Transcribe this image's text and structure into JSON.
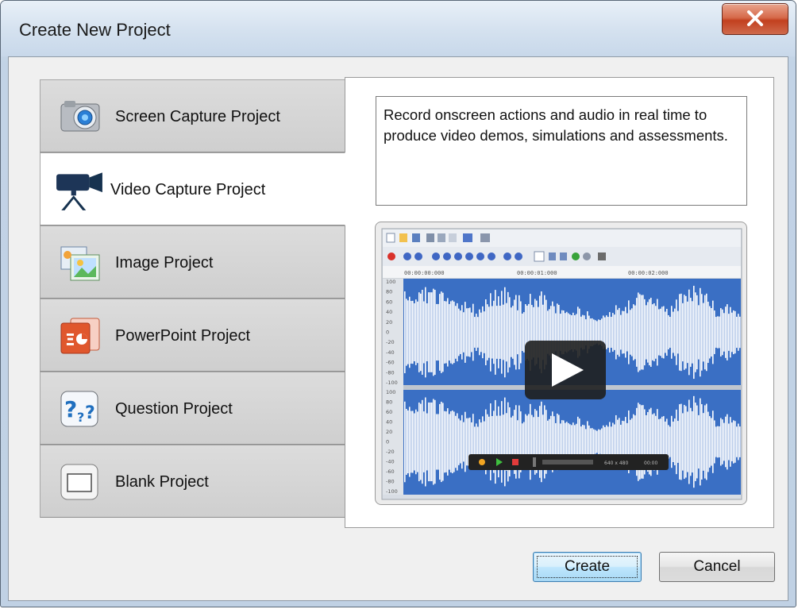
{
  "window": {
    "title": "Create New Project"
  },
  "tabs": [
    {
      "label": "Screen Capture Project",
      "icon": "camera-icon"
    },
    {
      "label": "Video Capture Project",
      "icon": "video-camera-icon",
      "selected": true
    },
    {
      "label": "Image Project",
      "icon": "image-icon"
    },
    {
      "label": "PowerPoint Project",
      "icon": "powerpoint-icon"
    },
    {
      "label": "Question Project",
      "icon": "question-icon"
    },
    {
      "label": "Blank Project",
      "icon": "blank-page-icon"
    }
  ],
  "description": "Record onscreen actions and audio in real time to produce video demos, simulations and assessments.",
  "preview": {
    "timecodes": [
      "00:00:00:000",
      "00:00:01:000",
      "00:00:02:000"
    ],
    "scale_labels": [
      "100",
      "80",
      "60",
      "40",
      "20",
      "0",
      "-20",
      "-40",
      "-60",
      "-80",
      "-100"
    ],
    "size_readout": "640 x 480",
    "time_readout": "00:00"
  },
  "buttons": {
    "create": "Create",
    "cancel": "Cancel"
  },
  "colors": {
    "waveform_bg": "#3a6fc4",
    "title_bar": "#d4e1ef",
    "close_button": "#c2401f"
  }
}
